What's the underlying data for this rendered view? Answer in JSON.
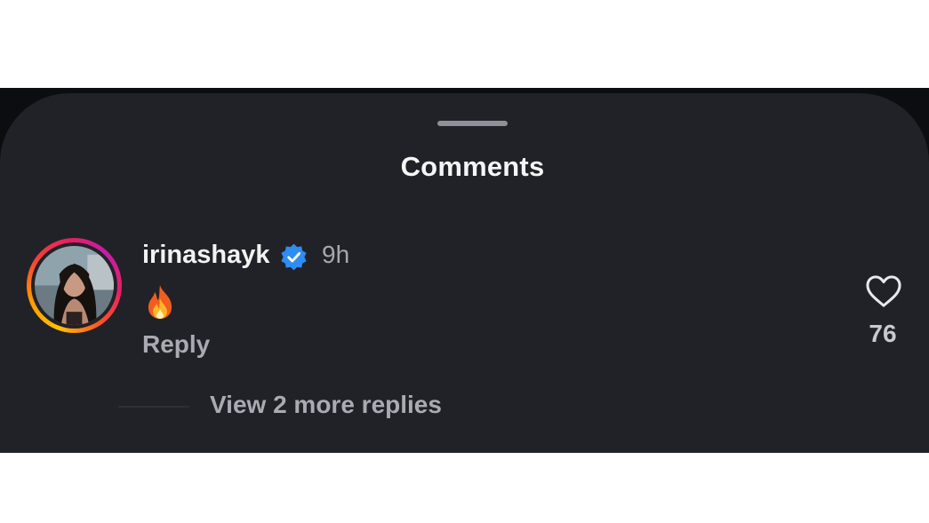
{
  "sheet": {
    "title": "Comments"
  },
  "comment": {
    "username": "irinashayk",
    "verified": true,
    "time": "9h",
    "text_emoji": "fire",
    "reply_label": "Reply",
    "like_count": "76",
    "view_more_replies": "View 2 more replies"
  },
  "colors": {
    "background": "#212227",
    "verified_badge": "#2f8cf2",
    "primary_text": "#f2f2f2",
    "secondary_text": "#a9abb3"
  },
  "icons": {
    "verified": "verified-badge-icon",
    "like": "heart-outline-icon",
    "emoji": "fire-emoji-icon"
  }
}
